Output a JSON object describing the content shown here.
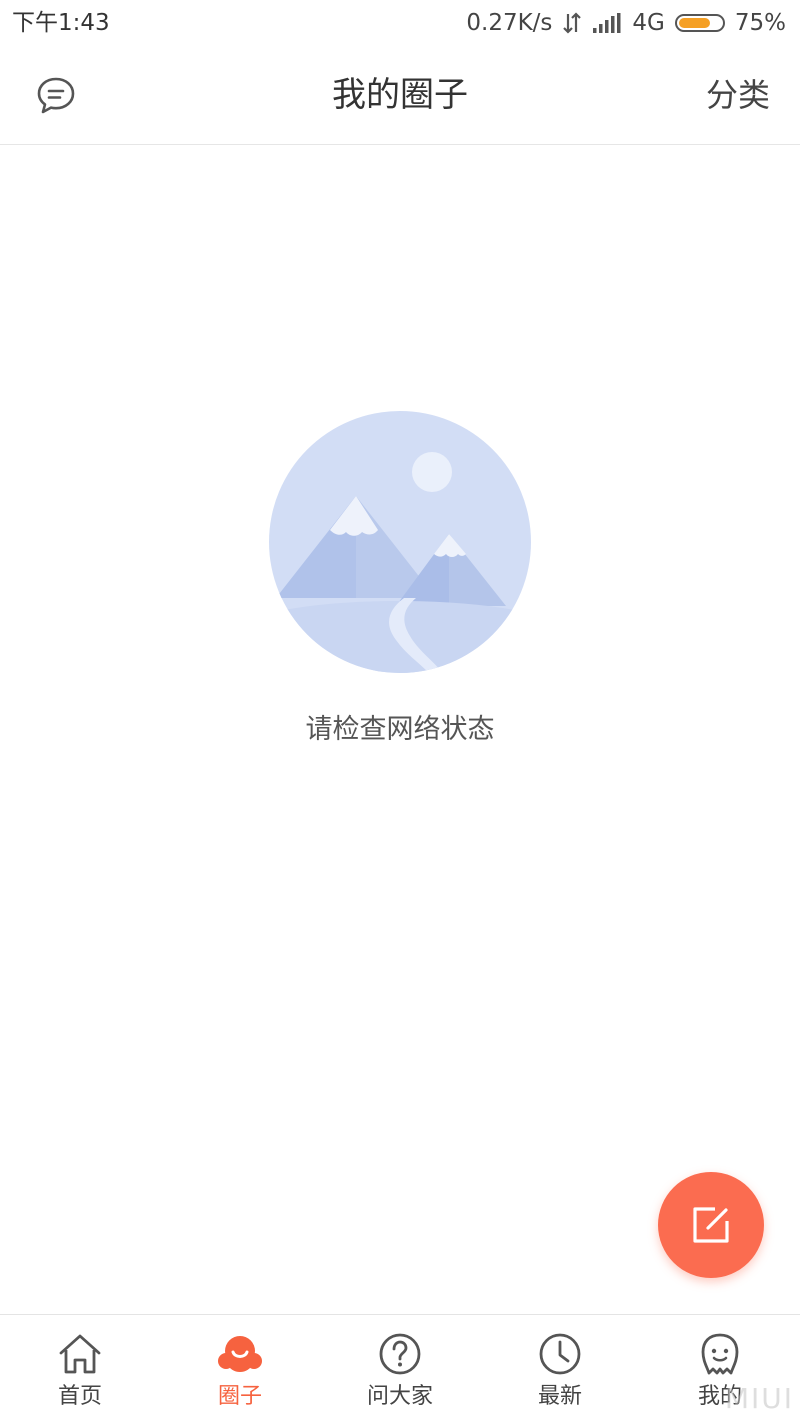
{
  "status_bar": {
    "time": "下午1:43",
    "network_speed": "0.27K/s",
    "network_type": "4G",
    "battery": "75%",
    "battery_level": 0.75
  },
  "header": {
    "title": "我的圈子",
    "right_action": "分类",
    "left_icon": "message-icon"
  },
  "empty_state": {
    "message": "请检查网络状态",
    "illustration": "mountain-landscape-illustration"
  },
  "fab": {
    "icon": "edit-icon"
  },
  "tabs": [
    {
      "label": "首页",
      "icon": "home-icon",
      "active": false
    },
    {
      "label": "圈子",
      "icon": "circle-icon",
      "active": true
    },
    {
      "label": "问大家",
      "icon": "question-icon",
      "active": false
    },
    {
      "label": "最新",
      "icon": "clock-icon",
      "active": false
    },
    {
      "label": "我的",
      "icon": "profile-icon",
      "active": false
    }
  ],
  "colors": {
    "accent": "#f6623f",
    "fab": "#fb6c50",
    "battery": "#f5a025"
  },
  "watermark": "MIUI"
}
